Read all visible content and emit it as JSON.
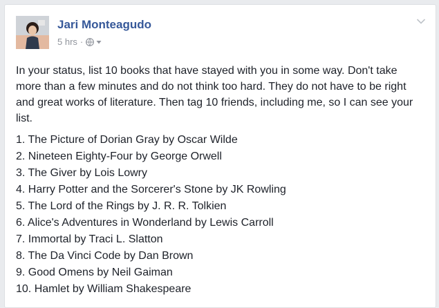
{
  "post": {
    "author_name": "Jari Monteagudo",
    "timestamp": "5 hrs",
    "separator": "·",
    "privacy_icon": "globe-icon",
    "audience_icon": "caret-down-icon",
    "menu_icon": "chevron-down-icon",
    "status_text": "In your status, list 10 books that have stayed with you in some way. Don't take more than a few minutes and do not think too hard. They do not have to be right and great works of literature. Then tag 10 friends, including me, so I can see your list.",
    "books": [
      "1. The Picture of Dorian Gray by Oscar Wilde",
      "2. Nineteen Eighty-Four by George Orwell",
      "3. The Giver by Lois Lowry",
      "4. Harry Potter and the Sorcerer's Stone by JK Rowling",
      "5. The Lord of the Rings by J. R. R. Tolkien",
      "6. Alice's Adventures in Wonderland by Lewis Carroll",
      "7. Immortal by Traci L. Slatton",
      "8. The Da Vinci Code by Dan Brown",
      "9. Good Omens by Neil Gaiman",
      "10. Hamlet by William Shakespeare"
    ]
  },
  "colors": {
    "name_link": "#365899",
    "body_text": "#1d2129",
    "meta_text": "#90949c",
    "card_border": "#dddfe2",
    "background": "#e9ebee"
  }
}
